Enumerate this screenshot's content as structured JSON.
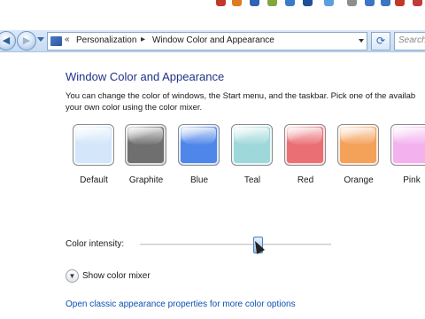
{
  "window": {
    "breadcrumb": {
      "overflow": "«",
      "items": [
        "Personalization",
        "Window Color and Appearance"
      ],
      "separator": "▸"
    },
    "search_placeholder": "Search"
  },
  "page": {
    "title": "Window Color and Appearance",
    "description_line1": "You can change the color of windows, the Start menu, and the taskbar. Pick one of the availab",
    "description_line2": "your own color using the color mixer."
  },
  "swatches": [
    {
      "label": "Default",
      "color": "#d3e6fa"
    },
    {
      "label": "Graphite",
      "color": "#6f6f6f"
    },
    {
      "label": "Blue",
      "color": "#4f86ea"
    },
    {
      "label": "Teal",
      "color": "#9fd8da"
    },
    {
      "label": "Red",
      "color": "#ea6f74"
    },
    {
      "label": "Orange",
      "color": "#f4a15a"
    },
    {
      "label": "Pink",
      "color": "#f3b2ee"
    }
  ],
  "intensity": {
    "label": "Color intensity:",
    "value_fraction": 0.62
  },
  "mixer": {
    "label": "Show color mixer"
  },
  "links": {
    "classic": "Open classic appearance properties for more color options"
  },
  "colors": {
    "title": "#1e3287",
    "link": "#0a50b4",
    "address_bar": "#c7dcf1"
  }
}
